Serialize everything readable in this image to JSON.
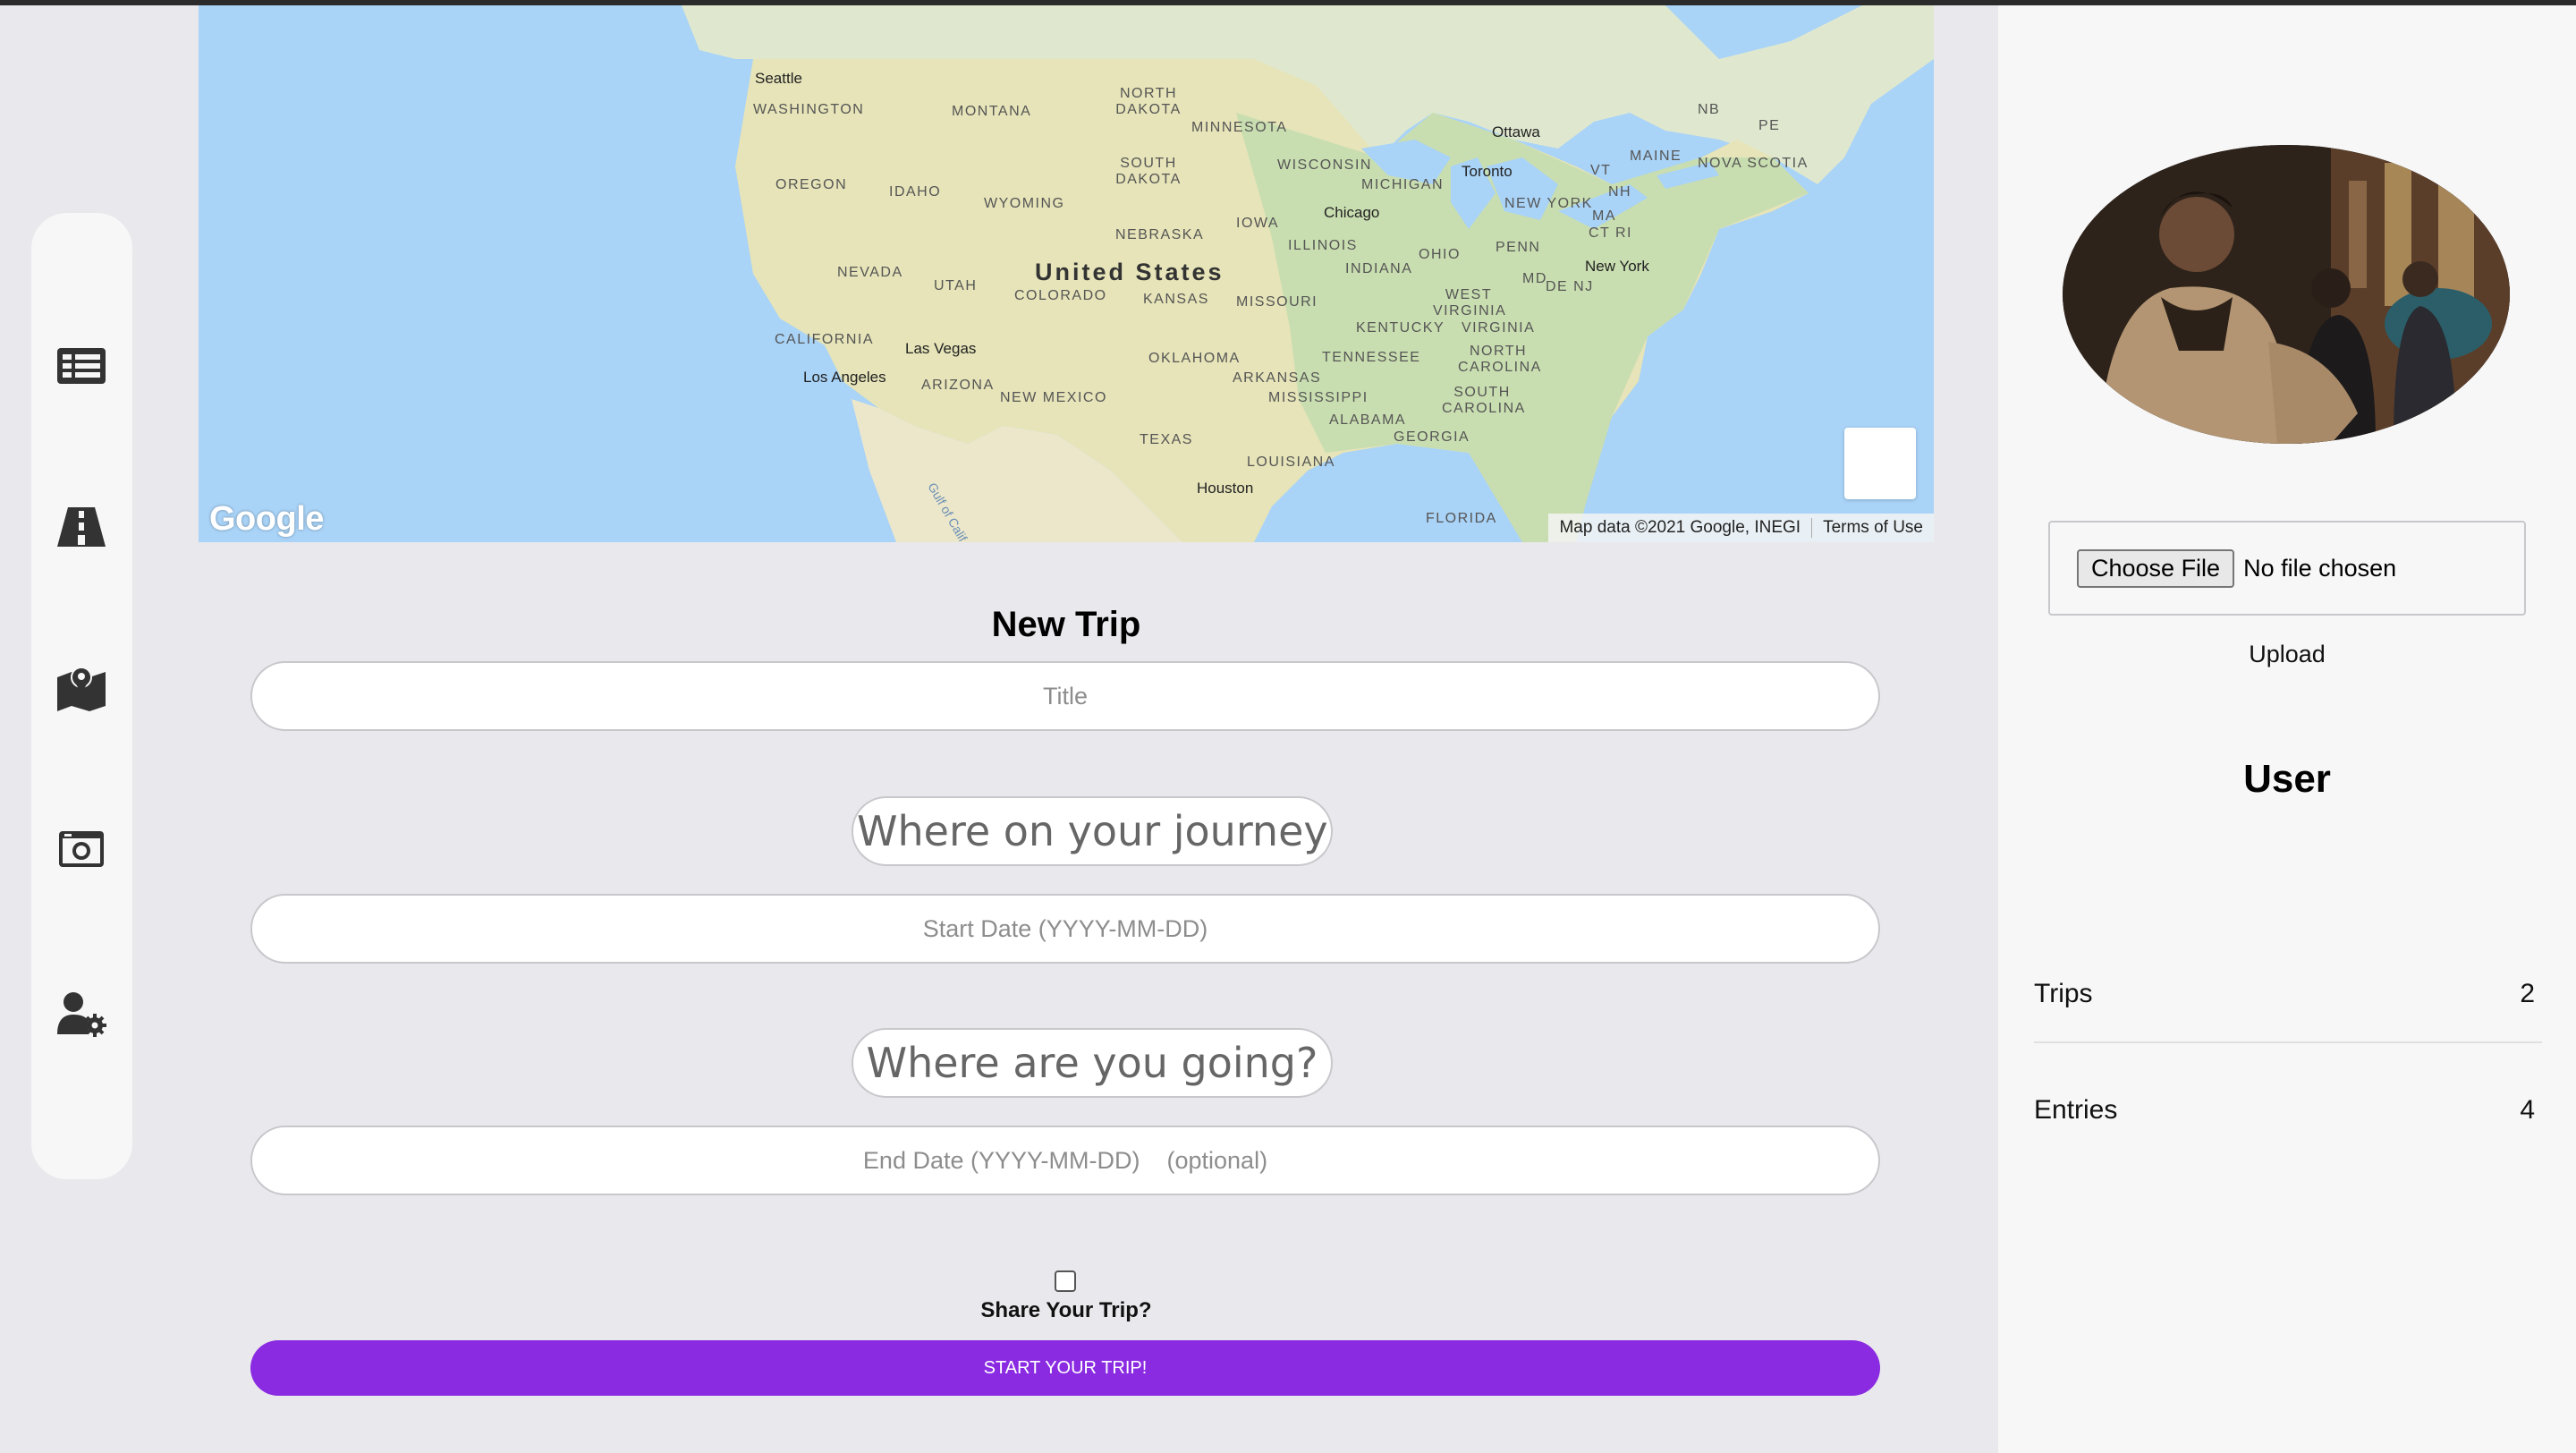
{
  "map": {
    "country_label": "United States",
    "state_labels": [
      "WASHINGTON",
      "MONTANA",
      "NORTH DAKOTA",
      "MINNESOTA",
      "OREGON",
      "IDAHO",
      "WYOMING",
      "SOUTH DAKOTA",
      "WISCONSIN",
      "MICHIGAN",
      "NEBRASKA",
      "IOWA",
      "NEVADA",
      "UTAH",
      "COLORADO",
      "KANSAS",
      "MISSOURI",
      "ILLINOIS",
      "INDIANA",
      "OHIO",
      "PENN",
      "CALIFORNIA",
      "ARIZONA",
      "NEW MEXICO",
      "OKLAHOMA",
      "ARKANSAS",
      "TENNESSEE",
      "KENTUCKY",
      "WEST VIRGINIA",
      "VIRGINIA",
      "NORTH CAROLINA",
      "SOUTH CAROLINA",
      "TEXAS",
      "LOUISIANA",
      "MISSISSIPPI",
      "ALABAMA",
      "GEORGIA",
      "FLORIDA",
      "NEW YORK",
      "VT",
      "NH",
      "MAINE",
      "MA",
      "CT RI",
      "MD",
      "DE NJ",
      "NB",
      "PE",
      "NOVA SCOTIA"
    ],
    "city_labels": [
      "Seattle",
      "Ottawa",
      "Toronto",
      "Chicago",
      "New York",
      "Las Vegas",
      "Los Angeles",
      "Houston"
    ],
    "water_label": "Gulf of Calif.",
    "logo_text": "Google",
    "attribution": "Map data ©2021 Google, INEGI",
    "terms_link": "Terms of Use"
  },
  "form": {
    "title": "New Trip",
    "title_placeholder": "Title",
    "origin_placeholder": "Where on your journey did you start?",
    "start_date_placeholder": "Start Date (YYYY-MM-DD)",
    "destination_placeholder": "Where are you going?",
    "end_date_placeholder": "End Date (YYYY-MM-DD)    (optional)",
    "share_label": "Share Your Trip?",
    "share_checked": false,
    "submit_label": "START YOUR TRIP!",
    "accent_color": "#8a2be2"
  },
  "sidebar": {
    "icons": [
      "list-icon",
      "road-icon",
      "map-icon",
      "camera-icon",
      "user-settings-icon"
    ]
  },
  "profile": {
    "file_button": "Choose File",
    "file_status": "No file chosen",
    "upload_label": "Upload",
    "username": "User",
    "stats": [
      {
        "label": "Trips",
        "value": "2"
      },
      {
        "label": "Entries",
        "value": "4"
      }
    ]
  }
}
